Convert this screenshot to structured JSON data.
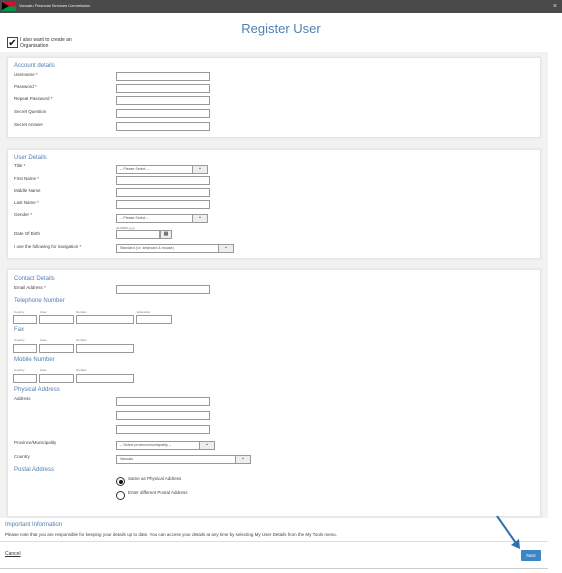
{
  "header": {
    "org_name": "Vanuatu Financial Services Commission",
    "close_glyph": "×"
  },
  "page": {
    "title": "Register User"
  },
  "org_checkbox": {
    "checked": true,
    "check_glyph": "✔",
    "label": "I also want to create an Organisation"
  },
  "account": {
    "heading": "Account details",
    "fields": [
      "Username *",
      "Password *",
      "Repeat Password *",
      "Secret Question",
      "Secret Answer"
    ]
  },
  "user": {
    "heading": "User Details",
    "title_label": "Title *",
    "title_select": "-- Please Select --",
    "first_name": "First Name *",
    "middle_name": "Middle Name",
    "last_name": "Last Name *",
    "gender_label": "Gender *",
    "gender_select": "-- Please Select --",
    "dob_hint": "dd-MMM-yyyy",
    "dob_label": "Date Of Birth",
    "nav_label": "I use the following for navigation *",
    "nav_select": "Standard (i.e. keyboard & mouse)"
  },
  "contact": {
    "heading": "Contact Details",
    "email_label": "Email Address *",
    "telephone_heading": "Telephone Number",
    "fax_heading": "Fax",
    "mobile_heading": "Mobile Number",
    "phone_cols": [
      "Country",
      "Area",
      "Number",
      "Extension"
    ],
    "physical_heading": "Physical Address",
    "address_label": "Address",
    "province_label": "Province/Municipality",
    "province_select": "-- Select province/municipality --",
    "country_label": "Country",
    "country_select": "Vanuatu",
    "postal_heading": "Postal Address",
    "postal_options": [
      {
        "label": "Same as Physical Address",
        "selected": true
      },
      {
        "label": "Enter different Postal Address",
        "selected": false
      }
    ]
  },
  "important": {
    "title": "Important Information",
    "text": "Please note that you are responsible for keeping your details up to date. You can access your details at any time by selecting My User Details from the My Tools menu."
  },
  "footer": {
    "cancel_label": "Cancel",
    "next_label": "Next"
  },
  "colors": {
    "accent": "#4f7fb5",
    "button": "#3d86c6",
    "arrow": "#2f6fb0"
  }
}
